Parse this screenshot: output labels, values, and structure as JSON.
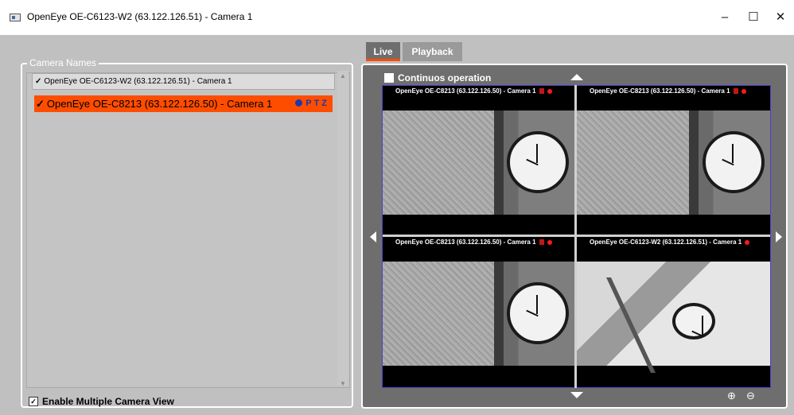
{
  "window": {
    "title": "OpenEye OE-C6123-W2 (63.122.126.51) - Camera 1",
    "minimize": "–",
    "maximize": "☐",
    "close": "✕"
  },
  "camera_panel": {
    "legend": "Camera Names",
    "items": [
      {
        "check": "✓",
        "label": "OpenEye OE-C6123-W2 (63.122.126.51) - Camera 1",
        "selected": false
      },
      {
        "check": "✓",
        "label": "OpenEye OE-C8213 (63.122.126.50) - Camera 1",
        "selected": true,
        "badge": "PTZ"
      }
    ],
    "enable_multi_label": "Enable Multiple Camera View",
    "enable_multi_checked": true,
    "enable_multi_check": "✓"
  },
  "tabs": [
    {
      "label": "Live",
      "active": true
    },
    {
      "label": "Playback",
      "active": false
    }
  ],
  "live": {
    "continuous_label": "Continuos operation",
    "cells": [
      {
        "label": "OpenEye OE-C8213 (63.122.126.50) - Camera 1"
      },
      {
        "label": "OpenEye OE-C8213 (63.122.126.50) - Camera 1"
      },
      {
        "label": "OpenEye OE-C8213 (63.122.126.50) - Camera 1"
      },
      {
        "label": "OpenEye OE-C6123-W2 (63.122.126.51) - Camera 1"
      }
    ],
    "zoom_in": "⊕",
    "zoom_out": "⊖"
  },
  "colors": {
    "accent": "#ff4d00",
    "grid_border": "#4a3fd0",
    "panel_bg": "#6e6e6e",
    "app_bg": "#c0c0c0"
  }
}
